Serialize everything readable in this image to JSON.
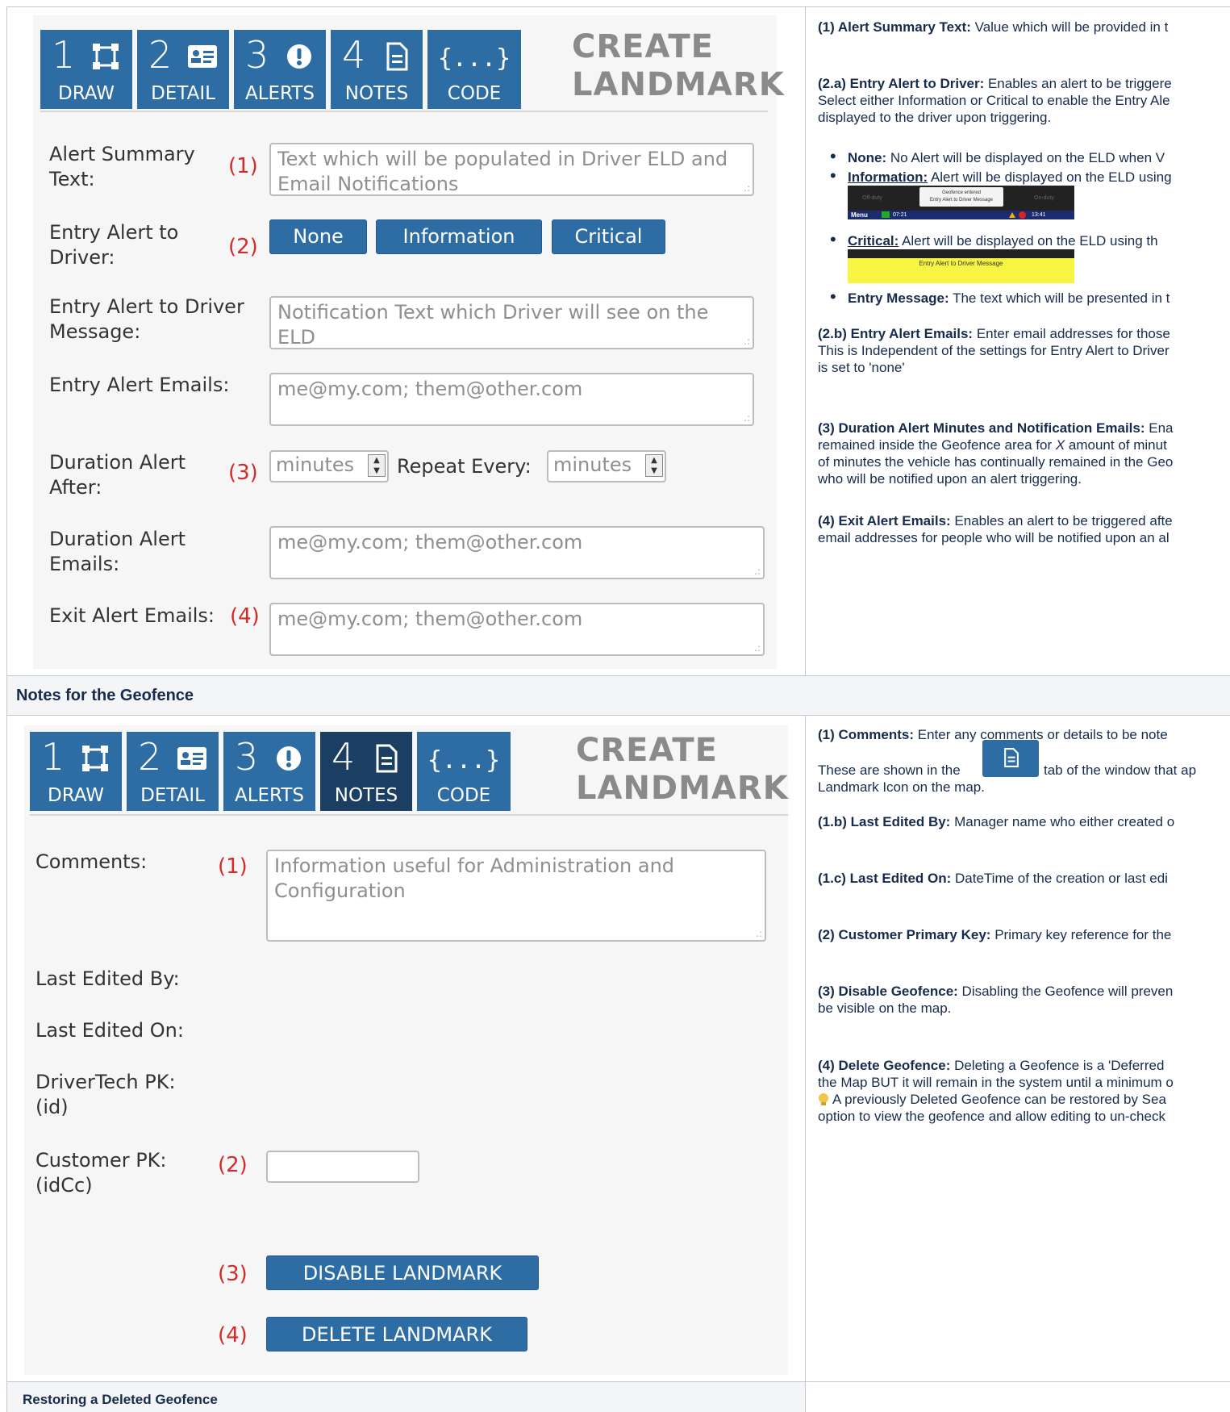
{
  "alerts_panel": {
    "tabs": [
      {
        "num": "1",
        "label": "DRAW",
        "icon": "draw-shape-icon"
      },
      {
        "num": "2",
        "label": "DETAIL",
        "icon": "id-card-icon"
      },
      {
        "num": "3",
        "label": "ALERTS",
        "icon": "alert-circle-icon"
      },
      {
        "num": "4",
        "label": "NOTES",
        "icon": "document-icon"
      },
      {
        "glyph": "{...}",
        "label": "CODE",
        "icon": "code-braces-icon"
      }
    ],
    "title_line1": "CREATE",
    "title_line2": "LANDMARK",
    "summary_label_1": "Alert Summary",
    "summary_label_2": "Text:",
    "summary_marker": "(1)",
    "summary_placeholder": "Text which will be populated in Driver ELD and Email Notifications",
    "entry_label_1": "Entry Alert to",
    "entry_label_2": "Driver:",
    "entry_marker": "(2)",
    "btn_none": "None",
    "btn_information": "Information",
    "btn_critical": "Critical",
    "msg_label_1": "Entry Alert to Driver",
    "msg_label_2": "Message:",
    "msg_placeholder": "Notification Text which Driver will see on the ELD",
    "emails_label": "Entry Alert Emails:",
    "emails_placeholder": "me@my.com; them@other.com",
    "dur_label_1": "Duration Alert",
    "dur_label_2": "After:",
    "dur_marker": "(3)",
    "minutes_placeholder": "minutes",
    "repeat_label": "Repeat Every:",
    "dur_emails_label_1": "Duration Alert",
    "dur_emails_label_2": "Emails:",
    "dur_emails_placeholder": "me@my.com; them@other.com",
    "exit_label": "Exit Alert Emails:",
    "exit_marker": "(4)",
    "exit_placeholder": "me@my.com; them@other.com"
  },
  "alerts_desc": {
    "d1_bold": "(1) Alert Summary Text:",
    "d1_text": " Value which will be provided in t",
    "d2a_bold": "(2.a) Entry Alert to Driver:",
    "d2a_text": " Enables an alert to be triggere",
    "d2a_line2": "Select either Information or Critical to enable the Entry Ale",
    "d2a_line3": "displayed to the driver upon triggering.",
    "b_none_bold": "None:",
    "b_none_text": "  No Alert will be displayed on the ELD when V",
    "b_info_bold": "Information:",
    "b_info_text": " Alert will be displayed on the ELD using",
    "b_crit_bold": "Critical:",
    "b_crit_text": "   Alert will be displayed on the ELD using th",
    "b_msg_bold": "Entry Message:",
    "b_msg_text": " The text which will be presented in t",
    "eld_info_left": "Off-duty",
    "eld_info_right": "On-duty",
    "eld_info_popup_1": "Geofence entered",
    "eld_info_popup_2": "Entry Alert to Driver Message",
    "eld_info_menu": "Menu",
    "eld_info_time_1": "07:21",
    "eld_info_time_2": "13:41",
    "eld_crit_msg": "Entry Alert to Driver Message",
    "d2b_bold": "(2.b) Entry Alert Emails:",
    "d2b_text": " Enter email addresses for those",
    "d2b_line2": "This is Independent of the settings for Entry Alert to Driver",
    "d2b_line3": "is set to 'none'",
    "d3_bold": "(3) Duration Alert Minutes and Notification Emails:",
    "d3_text": " Ena",
    "d3_line2_a": "remained inside the Geofence area for ",
    "d3_line2_x": "X",
    "d3_line2_b": " amount of minut",
    "d3_line3": "of minutes the vehicle has continually remained in the Geo",
    "d3_line4": "who will be notified upon an alert triggering.",
    "d4_bold": "(4) Exit Alert Emails:",
    "d4_text": " Enables an alert to be triggered afte",
    "d4_line2": "email addresses for people who will be notified upon an al"
  },
  "notes_header": "Notes for the Geofence",
  "notes_panel": {
    "tabs": [
      {
        "num": "1",
        "label": "DRAW"
      },
      {
        "num": "2",
        "label": "DETAIL"
      },
      {
        "num": "3",
        "label": "ALERTS"
      },
      {
        "num": "4",
        "label": "NOTES"
      },
      {
        "glyph": "{...}",
        "label": "CODE"
      }
    ],
    "title_line1": "CREATE",
    "title_line2": "LANDMARK",
    "comments_label": "Comments:",
    "comments_marker": "(1)",
    "comments_placeholder": "Information useful for Administration and Configuration",
    "edited_by_label": "Last Edited By:",
    "edited_on_label": "Last Edited On:",
    "pk_label_1": "DriverTech PK:",
    "pk_label_2": "(id)",
    "cpk_label_1": "Customer PK:",
    "cpk_label_2": "(idCc)",
    "cpk_marker": "(2)",
    "disable_marker": "(3)",
    "disable_btn": "DISABLE LANDMARK",
    "delete_marker": "(4)",
    "delete_btn": "DELETE LANDMARK"
  },
  "notes_desc": {
    "n1_bold": "(1) Comments:",
    "n1_text": " Enter any comments or details to be note",
    "n1_line2_a": "These are shown in the",
    "n1_line2_b": "tab of the window that ap",
    "n1_line3": "Landmark Icon on the map.",
    "n1b_bold": "(1.b) Last Edited By:",
    "n1b_text": " Manager name who either created o",
    "n1c_bold": "(1.c) Last Edited On:",
    "n1c_text": " DateTime of the creation or last edi",
    "n2_bold": "(2) Customer Primary Key:",
    "n2_text": " Primary key reference for the",
    "n3_bold": "(3) Disable Geofence:",
    "n3_text": " Disabling the Geofence will preven",
    "n3_line2": "be visible on the map.",
    "n4_bold": "(4) Delete Geofence:",
    "n4_text": " Deleting a Geofence is a 'Deferred",
    "n4_line2": "the Map BUT it will remain in the system until a minimum o",
    "n4_line3": " A previously Deleted Geofence can be restored by Sea",
    "n4_line4": "option to view the geofence and allow editing to un-check"
  },
  "restore_header": "Restoring a Deleted Geofence",
  "colors": {
    "tab_blue": "#2e6da4",
    "tab_active": "#1b3e63",
    "marker_red": "#d42a2a",
    "header_bg": "#f4f5f7"
  }
}
